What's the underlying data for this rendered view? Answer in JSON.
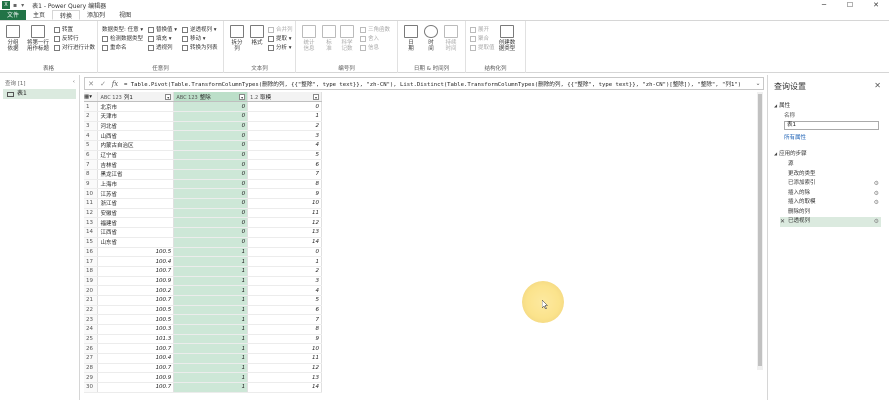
{
  "window": {
    "title": "表1 - Power Query 编辑器",
    "app_icon_letter": "X"
  },
  "tabs": [
    {
      "label": "文件"
    },
    {
      "label": "主页"
    },
    {
      "label": "转换"
    },
    {
      "label": "添加列"
    },
    {
      "label": "视图"
    }
  ],
  "ribbon": {
    "groups": [
      {
        "label": "表格"
      },
      {
        "label": "任意列"
      },
      {
        "label": "文本列"
      },
      {
        "label": "编号列"
      },
      {
        "label": "日期 & 时间列"
      },
      {
        "label": "结构化列"
      }
    ],
    "table": {
      "group_by": "分组\n依据",
      "first_row_header": "将第一行\n用作标题",
      "transpose": "转置",
      "reverse_rows": "反转行",
      "count_rows": "对行进行计数"
    },
    "any_column": {
      "data_type": "数据类型: 任意",
      "detect_type": "检测数据类型",
      "rename": "重命名",
      "replace_values": "替换值",
      "fill": "填充",
      "pivot": "透视列",
      "unpivot": "逆透视列",
      "move": "移动",
      "convert_list": "转换为列表"
    },
    "text_column": {
      "split": "拆分\n列",
      "format": "格式",
      "merge": "合并列",
      "extract": "提取",
      "parse": "分析"
    },
    "number_column": {
      "statistics": "统计\n信息",
      "standard": "标\n准",
      "scientific": "科学\n记数",
      "trig": "三角函数",
      "rounding": "舍入",
      "information": "信息"
    },
    "datetime_column": {
      "date": "日\n期",
      "time": "时\n间",
      "duration": "持续\n时间"
    },
    "structured_column": {
      "expand": "展开",
      "aggregate": "聚合",
      "extract_values": "提取值",
      "create_data_type": "创建数\n据类型"
    }
  },
  "formula_bar": {
    "formula": "= Table.Pivot(Table.TransformColumnTypes(删除的列, {{\"整除\", type text}}, \"zh-CN\"), List.Distinct(Table.TransformColumnTypes(删除的列, {{\"整除\", type text}}, \"zh-CN\")[整除]), \"整除\", \"列1\")"
  },
  "nav_pane": {
    "header": "查询 [1]",
    "queries": [
      {
        "name": "表1"
      }
    ]
  },
  "grid": {
    "columns": [
      {
        "type_icon": "ABC 123",
        "name": "列1"
      },
      {
        "type_icon": "ABC 123",
        "name": "整除"
      },
      {
        "type_icon": "1.2",
        "name": "取模"
      }
    ],
    "rows": [
      [
        "1",
        "北京市",
        "0",
        "0"
      ],
      [
        "2",
        "天津市",
        "0",
        "1"
      ],
      [
        "3",
        "河北省",
        "0",
        "2"
      ],
      [
        "4",
        "山西省",
        "0",
        "3"
      ],
      [
        "5",
        "内蒙古自治区",
        "0",
        "4"
      ],
      [
        "6",
        "辽宁省",
        "0",
        "5"
      ],
      [
        "7",
        "吉林省",
        "0",
        "6"
      ],
      [
        "8",
        "黑龙江省",
        "0",
        "7"
      ],
      [
        "9",
        "上海市",
        "0",
        "8"
      ],
      [
        "10",
        "江苏省",
        "0",
        "9"
      ],
      [
        "11",
        "浙江省",
        "0",
        "10"
      ],
      [
        "12",
        "安徽省",
        "0",
        "11"
      ],
      [
        "13",
        "福建省",
        "0",
        "12"
      ],
      [
        "14",
        "江西省",
        "0",
        "13"
      ],
      [
        "15",
        "山东省",
        "0",
        "14"
      ],
      [
        "16",
        "100.5",
        "1",
        "0"
      ],
      [
        "17",
        "100.4",
        "1",
        "1"
      ],
      [
        "18",
        "100.7",
        "1",
        "2"
      ],
      [
        "19",
        "100.9",
        "1",
        "3"
      ],
      [
        "20",
        "100.2",
        "1",
        "4"
      ],
      [
        "21",
        "100.7",
        "1",
        "5"
      ],
      [
        "22",
        "100.5",
        "1",
        "6"
      ],
      [
        "23",
        "100.5",
        "1",
        "7"
      ],
      [
        "24",
        "100.3",
        "1",
        "8"
      ],
      [
        "25",
        "101.3",
        "1",
        "9"
      ],
      [
        "26",
        "100.7",
        "1",
        "10"
      ],
      [
        "27",
        "100.4",
        "1",
        "11"
      ],
      [
        "28",
        "100.7",
        "1",
        "12"
      ],
      [
        "29",
        "100.9",
        "1",
        "13"
      ],
      [
        "30",
        "100.7",
        "1",
        "14"
      ]
    ]
  },
  "query_settings": {
    "title": "查询设置",
    "properties_label": "属性",
    "name_label": "名称",
    "name_value": "表1",
    "all_properties": "所有属性",
    "applied_steps_label": "应用的步骤",
    "steps": [
      {
        "label": "源",
        "has_gear": false,
        "active": false
      },
      {
        "label": "更改的类型",
        "has_gear": false,
        "active": false
      },
      {
        "label": "已添加索引",
        "has_gear": true,
        "active": false
      },
      {
        "label": "插入的除",
        "has_gear": true,
        "active": false
      },
      {
        "label": "插入的取模",
        "has_gear": true,
        "active": false
      },
      {
        "label": "删除的列",
        "has_gear": false,
        "active": false
      },
      {
        "label": "已透视列",
        "has_gear": true,
        "active": true
      }
    ]
  },
  "colors": {
    "excel_green": "#217346",
    "selected_column": "#cde7d7",
    "selected_step": "#dbeadf",
    "cursor_highlight": "#fbe38c"
  }
}
